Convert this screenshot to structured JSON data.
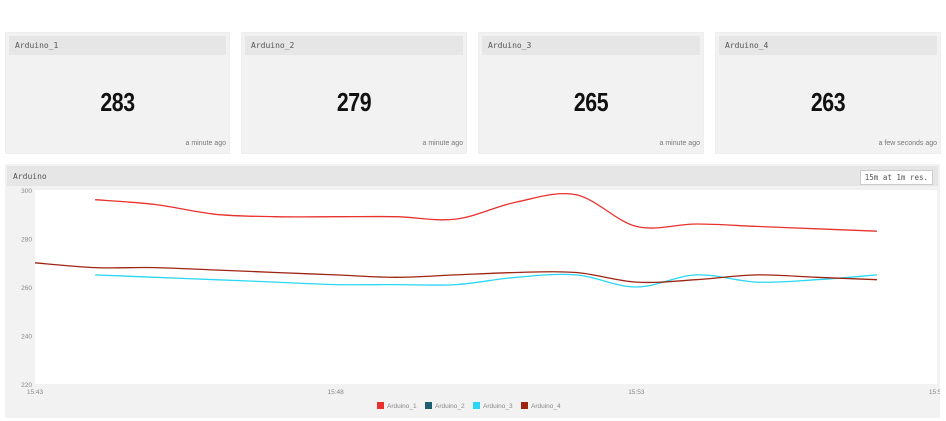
{
  "tiles": [
    {
      "title": "Arduino_1",
      "value": "283",
      "time": "a minute ago"
    },
    {
      "title": "Arduino_2",
      "value": "279",
      "time": "a minute ago"
    },
    {
      "title": "Arduino_3",
      "value": "265",
      "time": "a minute ago"
    },
    {
      "title": "Arduino_4",
      "value": "263",
      "time": "a few seconds ago"
    }
  ],
  "chart_panel": {
    "title": "Arduino",
    "range_label": "15m at 1m res."
  },
  "chart_data": {
    "type": "line",
    "x_ticks": [
      "15:43",
      "15:48",
      "15:53",
      "15:58"
    ],
    "y_ticks": [
      220,
      240,
      260,
      280,
      300
    ],
    "ylim": [
      220,
      300
    ],
    "xlim": [
      "15:43",
      "15:58"
    ],
    "series": [
      {
        "name": "Arduino_1",
        "color": "#e8322d",
        "x": [
          "15:44",
          "15:45",
          "15:46",
          "15:47",
          "15:48",
          "15:49",
          "15:50",
          "15:51",
          "15:52",
          "15:53",
          "15:54",
          "15:55",
          "15:56",
          "15:57"
        ],
        "values": [
          296,
          294,
          290,
          289,
          289,
          289,
          288,
          295,
          298,
          285,
          286,
          285,
          284,
          283
        ]
      },
      {
        "name": "Arduino_2",
        "color": "#1d5f6e",
        "x": [],
        "values": []
      },
      {
        "name": "Arduino_3",
        "color": "#29d6f5",
        "x": [
          "15:44",
          "15:45",
          "15:46",
          "15:47",
          "15:48",
          "15:49",
          "15:50",
          "15:51",
          "15:52",
          "15:53",
          "15:54",
          "15:55",
          "15:56",
          "15:57"
        ],
        "values": [
          265,
          264,
          263,
          262,
          261,
          261,
          261,
          264,
          265,
          260,
          265,
          262,
          263,
          265
        ]
      },
      {
        "name": "Arduino_4",
        "color": "#9e2413",
        "x": [
          "15:43",
          "15:44",
          "15:45",
          "15:46",
          "15:47",
          "15:48",
          "15:49",
          "15:50",
          "15:51",
          "15:52",
          "15:53",
          "15:54",
          "15:55",
          "15:56",
          "15:57"
        ],
        "values": [
          270,
          268,
          268,
          267,
          266,
          265,
          264,
          265,
          266,
          266,
          262,
          263,
          265,
          264,
          263
        ]
      }
    ],
    "legend_position": "bottom-center",
    "grid": false
  }
}
